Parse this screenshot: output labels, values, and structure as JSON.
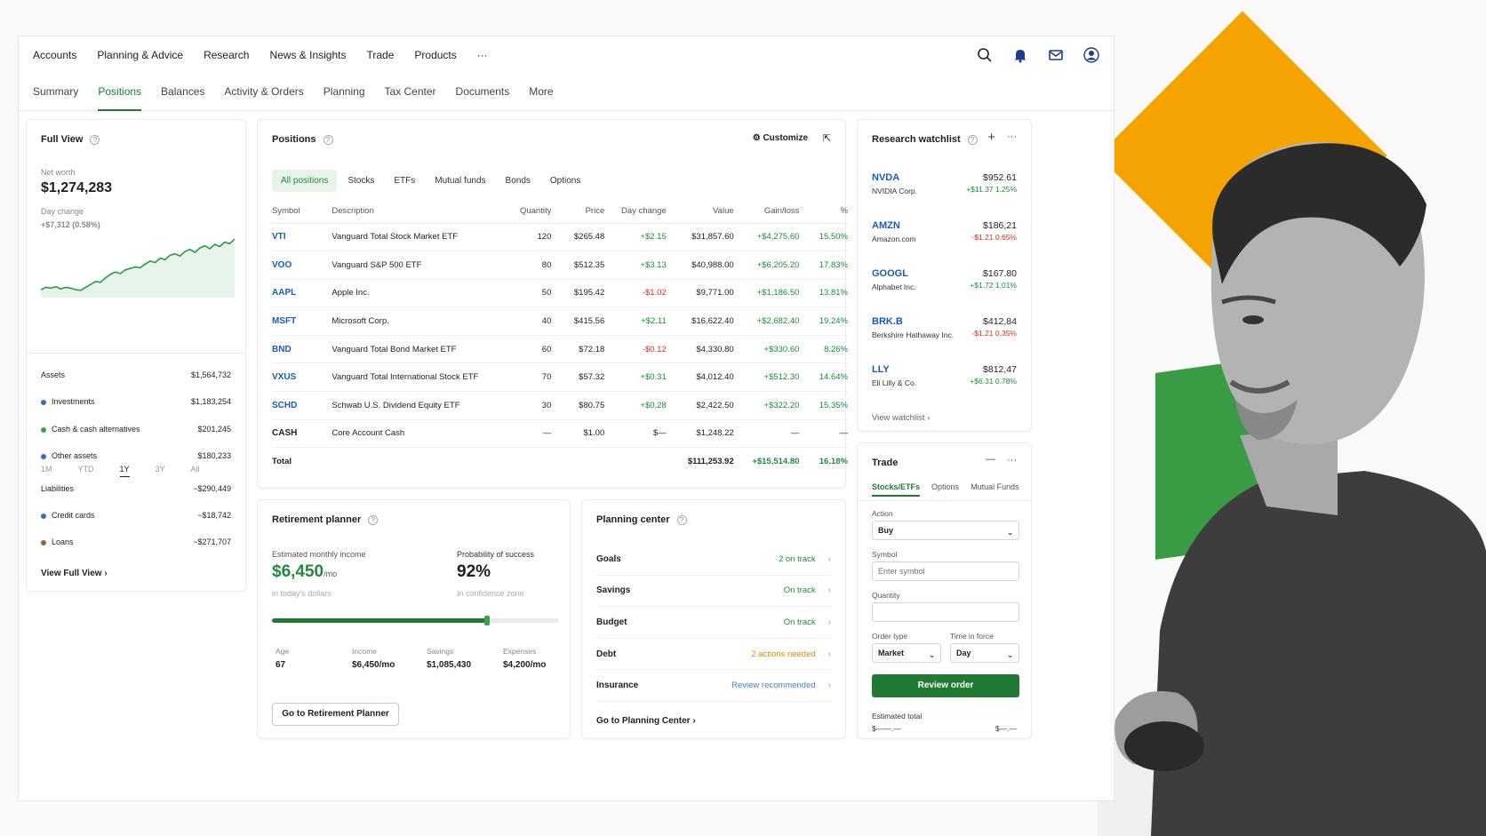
{
  "top_nav": [
    "Accounts",
    "Planning & Advice",
    "Research",
    "News & Insights",
    "Trade",
    "Products",
    "···"
  ],
  "sub_nav": [
    "Summary",
    "Positions",
    "Balances",
    "Activity & Orders",
    "Planning",
    "Tax Center",
    "Documents",
    "More"
  ],
  "sub_nav_active": "Positions",
  "full_view": {
    "title": "Full View",
    "net_worth_label": "Net worth",
    "net_worth": "$1,274,283",
    "day_change_label": "Day change",
    "day_change": "+$7,312 (0.58%)",
    "ranges": [
      "1M",
      "YTD",
      "1Y",
      "3Y",
      "All"
    ],
    "active_range": "1Y",
    "assets_label": "Assets",
    "assets_value": "$1,564,732",
    "assets": [
      {
        "label": "Investments",
        "value": "$1,183,254",
        "color": "#2f6fc4"
      },
      {
        "label": "Cash & cash alternatives",
        "value": "$201,245",
        "color": "#33a84b"
      },
      {
        "label": "Other assets",
        "value": "$180,233",
        "color": "#2f6fc4"
      }
    ],
    "liabilities_label": "Liabilities",
    "liabilities_value": "−$290,449",
    "liabilities": [
      {
        "label": "Credit cards",
        "value": "−$18,742",
        "color": "#2f6fc4"
      },
      {
        "label": "Loans",
        "value": "−$271,707",
        "color": "#8b6a3a"
      }
    ],
    "link": "View Full View",
    "link_chevron": "›"
  },
  "positions": {
    "title": "Positions",
    "customize": "Customize",
    "tabs": [
      "All positions",
      "Stocks",
      "ETFs",
      "Mutual funds",
      "Bonds",
      "Options"
    ],
    "active_tab": "All positions",
    "headers": [
      "Symbol",
      "Description",
      "Quantity",
      "Price",
      "Day change",
      "Value",
      "Gain/loss",
      "%"
    ],
    "rows": [
      [
        "VTI",
        "Vanguard Total Stock Market ETF",
        "120",
        "$265.48",
        "+$2.15",
        "$31,857.60",
        "+$4,275.60",
        "15.50%"
      ],
      [
        "VOO",
        "Vanguard S&P 500 ETF",
        "80",
        "$512.35",
        "+$3.13",
        "$40,988.00",
        "+$6,205.20",
        "17.83%"
      ],
      [
        "AAPL",
        "Apple Inc.",
        "50",
        "$195.42",
        "-$1.02",
        "$9,771.00",
        "+$1,186.50",
        "13.81%"
      ],
      [
        "MSFT",
        "Microsoft Corp.",
        "40",
        "$415.56",
        "+$2.11",
        "$16,622.40",
        "+$2,682.40",
        "19.24%"
      ],
      [
        "BND",
        "Vanguard Total Bond Market ETF",
        "60",
        "$72.18",
        "-$0.12",
        "$4,330.80",
        "+$330.60",
        "8.26%"
      ],
      [
        "VXUS",
        "Vanguard Total International Stock ETF",
        "70",
        "$57.32",
        "+$0.31",
        "$4,012.40",
        "+$512.30",
        "14.64%"
      ],
      [
        "SCHD",
        "Schwab U.S. Dividend Equity ETF",
        "30",
        "$80.75",
        "+$0.28",
        "$2,422.50",
        "+$322.20",
        "15.35%"
      ],
      [
        "CASH",
        "Core Account Cash",
        "—",
        "$1.00",
        "$—",
        "$1,248.22",
        "—",
        "—"
      ]
    ],
    "total": [
      "Total",
      "",
      "",
      "",
      "",
      "$111,253.92",
      "+$15,514.80",
      "16.18%"
    ]
  },
  "retirement": {
    "title": "Retirement planner",
    "income_label": "Estimated monthly income",
    "income": "$6,450",
    "income_unit": "/mo",
    "income_note": "in today's dollars",
    "prob_label": "Probability of success",
    "prob": "92%",
    "prob_note": "In confidence zone",
    "progress": 0.75,
    "stats": [
      {
        "label": "Age",
        "value": "67"
      },
      {
        "label": "Income",
        "value": "$6,450/mo"
      },
      {
        "label": "Savings",
        "value": "$1,085,430"
      },
      {
        "label": "Expenses",
        "value": "$4,200/mo"
      }
    ],
    "button": "Go to Retirement Planner"
  },
  "planning_center": {
    "title": "Planning center",
    "rows": [
      {
        "label": "Goals",
        "status": "2 on track",
        "color": "#1e8a3c"
      },
      {
        "label": "Savings",
        "status": "On track",
        "color": "#1e8a3c"
      },
      {
        "label": "Budget",
        "status": "On track",
        "color": "#1e8a3c"
      },
      {
        "label": "Debt",
        "status": "2 actions needed",
        "color": "#e08a00"
      },
      {
        "label": "Insurance",
        "status": "Review recommended",
        "color": "#4a7fc4"
      }
    ],
    "link": "Go to Planning Center",
    "chevron": "›"
  },
  "watchlist": {
    "title": "Research watchlist",
    "items": [
      {
        "symbol": "NVDA",
        "name": "NVIDIA Corp.",
        "price": "$952.61",
        "change": "+$11.37 1.25%",
        "color": "#1e8a3c"
      },
      {
        "symbol": "AMZN",
        "name": "Amazon.com",
        "price": "$186,21",
        "change": "-$1.21 0.65%",
        "color": "#d62d20"
      },
      {
        "symbol": "GOOGL",
        "name": "Alphabet Inc.",
        "price": "$167.80",
        "change": "+$1.72 1.01%",
        "color": "#1e8a3c"
      },
      {
        "symbol": "BRK.B",
        "name": "Berkshire Hathaway Inc.",
        "price": "$412,84",
        "change": "-$1.21 0.35%",
        "color": "#d62d20"
      },
      {
        "symbol": "LLY",
        "name": "Eli Lilly & Co.",
        "price": "$812,47",
        "change": "+$6.31 0.78%",
        "color": "#1e8a3c"
      }
    ],
    "link": "View watchlist",
    "chevron": "›"
  },
  "trade": {
    "title": "Trade",
    "tabs": [
      "Stocks/ETFs",
      "Options",
      "Mutual Funds"
    ],
    "active_tab": "Stocks/ETFs",
    "action_label": "Action",
    "action_value": "Buy",
    "symbol_label": "Symbol",
    "symbol_placeholder": "Enter symbol",
    "quantity_label": "Quantity",
    "order_type_label": "Order type",
    "order_type_value": "Market",
    "tif_label": "Time in force",
    "tif_value": "Day",
    "button": "Review order",
    "estimated_label": "Estimated total",
    "estimated_left": "$——.—",
    "estimated_right": "$—.—"
  },
  "colors": {
    "brand_green": "#1f7a34",
    "gain": "#1e8a3c",
    "loss": "#d62d20",
    "link_blue": "#1b5bb6",
    "accent_orange": "#f5a300"
  },
  "chart_data": {
    "type": "line",
    "values": [
      31,
      34,
      33,
      35,
      32,
      34,
      33,
      31,
      30,
      34,
      38,
      42,
      41,
      47,
      52,
      55,
      53,
      58,
      60,
      62,
      61,
      66,
      70,
      68,
      74,
      72,
      78,
      80,
      77,
      83,
      86,
      82,
      88,
      91,
      87,
      93,
      90,
      96,
      94,
      100
    ],
    "ylim": [
      20,
      110
    ],
    "grid": false
  }
}
